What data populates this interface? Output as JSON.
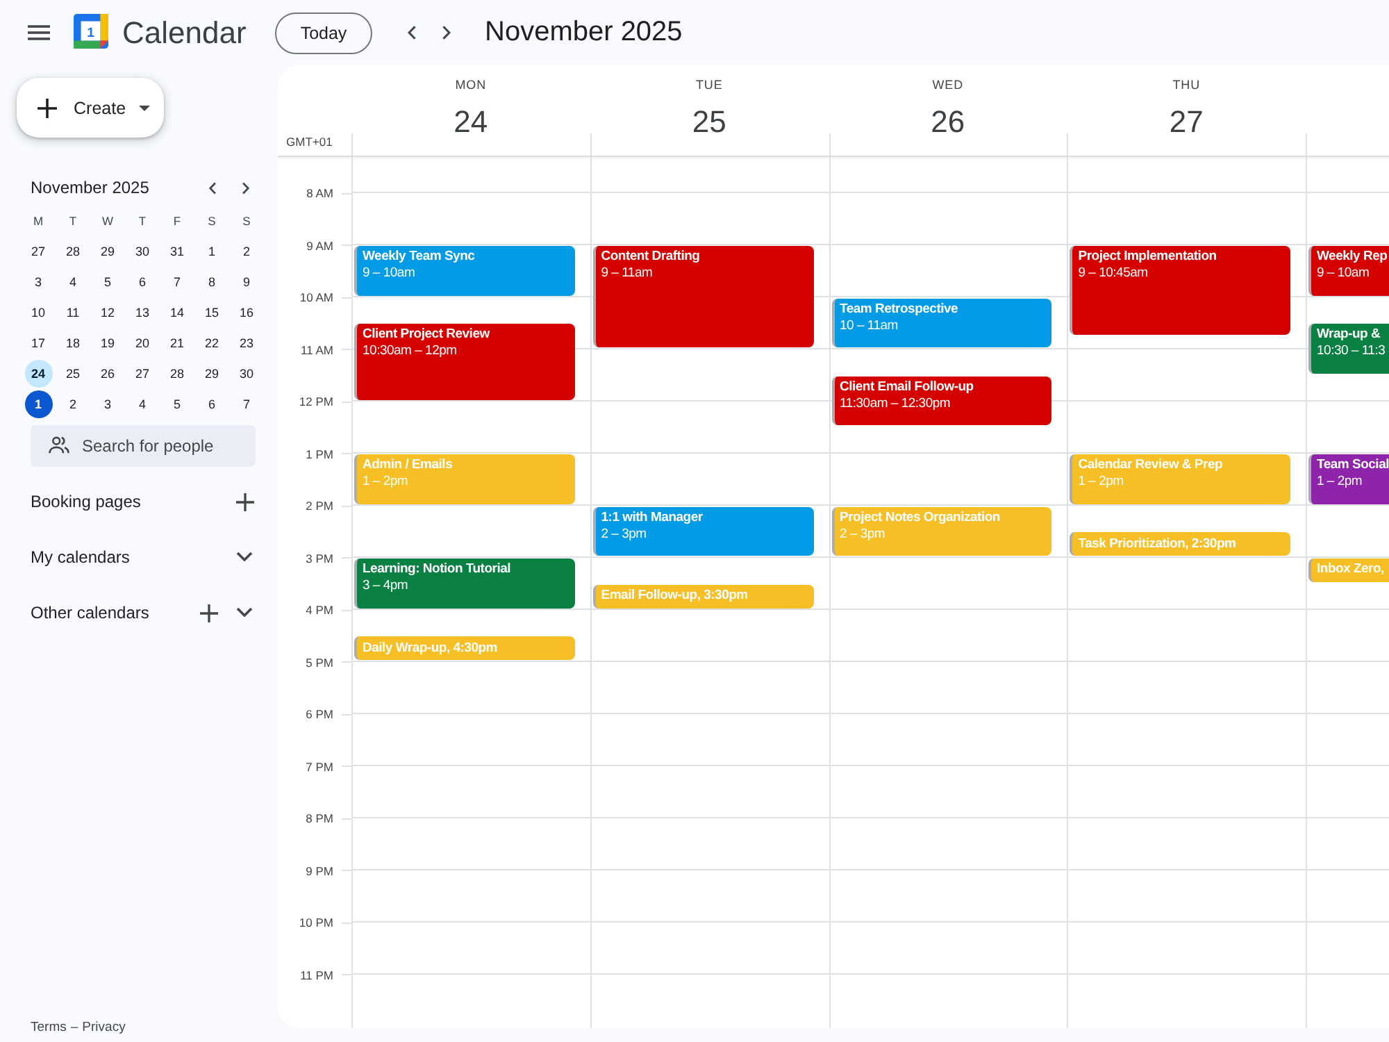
{
  "header": {
    "logo_text": "1",
    "app_name": "Calendar",
    "today_button": "Today",
    "period": "November 2025"
  },
  "create_button": {
    "label": "Create"
  },
  "mini_calendar": {
    "title": "November 2025",
    "weekdays": [
      "M",
      "T",
      "W",
      "T",
      "F",
      "S",
      "S"
    ],
    "weeks": [
      [
        {
          "day": "27",
          "selected": false,
          "today": false
        },
        {
          "day": "28",
          "selected": false,
          "today": false
        },
        {
          "day": "29",
          "selected": false,
          "today": false
        },
        {
          "day": "30",
          "selected": false,
          "today": false
        },
        {
          "day": "31",
          "selected": false,
          "today": false
        },
        {
          "day": "1",
          "selected": false,
          "today": false
        },
        {
          "day": "2",
          "selected": false,
          "today": false
        }
      ],
      [
        {
          "day": "3",
          "selected": false,
          "today": false
        },
        {
          "day": "4",
          "selected": false,
          "today": false
        },
        {
          "day": "5",
          "selected": false,
          "today": false
        },
        {
          "day": "6",
          "selected": false,
          "today": false
        },
        {
          "day": "7",
          "selected": false,
          "today": false
        },
        {
          "day": "8",
          "selected": false,
          "today": false
        },
        {
          "day": "9",
          "selected": false,
          "today": false
        }
      ],
      [
        {
          "day": "10",
          "selected": false,
          "today": false
        },
        {
          "day": "11",
          "selected": false,
          "today": false
        },
        {
          "day": "12",
          "selected": false,
          "today": false
        },
        {
          "day": "13",
          "selected": false,
          "today": false
        },
        {
          "day": "14",
          "selected": false,
          "today": false
        },
        {
          "day": "15",
          "selected": false,
          "today": false
        },
        {
          "day": "16",
          "selected": false,
          "today": false
        }
      ],
      [
        {
          "day": "17",
          "selected": false,
          "today": false
        },
        {
          "day": "18",
          "selected": false,
          "today": false
        },
        {
          "day": "19",
          "selected": false,
          "today": false
        },
        {
          "day": "20",
          "selected": false,
          "today": false
        },
        {
          "day": "21",
          "selected": false,
          "today": false
        },
        {
          "day": "22",
          "selected": false,
          "today": false
        },
        {
          "day": "23",
          "selected": false,
          "today": false
        }
      ],
      [
        {
          "day": "24",
          "selected": true,
          "today": false
        },
        {
          "day": "25",
          "selected": false,
          "today": false
        },
        {
          "day": "26",
          "selected": false,
          "today": false
        },
        {
          "day": "27",
          "selected": false,
          "today": false
        },
        {
          "day": "28",
          "selected": false,
          "today": false
        },
        {
          "day": "29",
          "selected": false,
          "today": false
        },
        {
          "day": "30",
          "selected": false,
          "today": false
        }
      ],
      [
        {
          "day": "1",
          "selected": false,
          "today": true
        },
        {
          "day": "2",
          "selected": false,
          "today": false
        },
        {
          "day": "3",
          "selected": false,
          "today": false
        },
        {
          "day": "4",
          "selected": false,
          "today": false
        },
        {
          "day": "5",
          "selected": false,
          "today": false
        },
        {
          "day": "6",
          "selected": false,
          "today": false
        },
        {
          "day": "7",
          "selected": false,
          "today": false
        }
      ]
    ]
  },
  "people_search": {
    "placeholder": "Search for people"
  },
  "sections": [
    {
      "label": "Booking pages",
      "kind": "add"
    },
    {
      "label": "My calendars",
      "kind": "collapsible",
      "expanded": false
    },
    {
      "label": "Other calendars",
      "kind": "add_collapsible",
      "expanded": false
    }
  ],
  "footer": {
    "links": [
      "Terms",
      "Privacy"
    ],
    "separator": "–"
  },
  "week": {
    "timezone": "GMT+01",
    "hours": [
      "8 AM",
      "9 AM",
      "10 AM",
      "11 AM",
      "12 PM",
      "1 PM",
      "2 PM",
      "3 PM",
      "4 PM",
      "5 PM",
      "6 PM",
      "7 PM",
      "8 PM",
      "9 PM",
      "10 PM",
      "11 PM"
    ],
    "days": [
      {
        "weekday": "MON",
        "date": "24",
        "events": [
          {
            "kind": "block",
            "title": "Weekly Team Sync",
            "time": "9 – 10am",
            "color": "#039be5"
          },
          {
            "kind": "block",
            "title": "Client Project Review",
            "time": "10:30am – 12pm",
            "color": "#d50000"
          },
          {
            "kind": "block",
            "title": "Admin / Emails",
            "time": "1 – 2pm",
            "color": "#f6bf26"
          },
          {
            "kind": "block",
            "title": "Learning: Notion Tutorial",
            "time": "3 – 4pm",
            "color": "#0b8043"
          },
          {
            "kind": "compact",
            "label": "Daily Wrap-up, 4:30pm",
            "color": "#f6bf26"
          }
        ]
      },
      {
        "weekday": "TUE",
        "date": "25",
        "events": [
          {
            "kind": "block",
            "title": "Content Drafting",
            "time": "9 – 11am",
            "color": "#d50000"
          },
          {
            "kind": "block",
            "title": "1:1 with Manager",
            "time": "2 – 3pm",
            "color": "#039be5"
          },
          {
            "kind": "compact",
            "label": "Email Follow-up, 3:30pm",
            "color": "#f6bf26"
          }
        ]
      },
      {
        "weekday": "WED",
        "date": "26",
        "events": [
          {
            "kind": "block",
            "title": "Team Retrospective",
            "time": "10 – 11am",
            "color": "#039be5"
          },
          {
            "kind": "block",
            "title": "Client Email Follow-up",
            "time": "11:30am – 12:30pm",
            "color": "#d50000"
          },
          {
            "kind": "block",
            "title": "Project Notes Organization",
            "time": "2 – 3pm",
            "color": "#f6bf26"
          }
        ]
      },
      {
        "weekday": "THU",
        "date": "27",
        "events": [
          {
            "kind": "block",
            "title": "Project Implementation",
            "time": "9 – 10:45am",
            "color": "#d50000"
          },
          {
            "kind": "block",
            "title": "Calendar Review & Prep",
            "time": "1 – 2pm",
            "color": "#f6bf26"
          },
          {
            "kind": "compact",
            "label": "Task Prioritization, 2:30pm",
            "color": "#f6bf26"
          }
        ]
      },
      {
        "events": [
          {
            "kind": "block",
            "title": "Weekly Rep",
            "time": "9 – 10am",
            "color": "#d50000"
          },
          {
            "kind": "block",
            "title": "Wrap-up &",
            "time": "10:30 – 11:3",
            "color": "#0b8043"
          },
          {
            "kind": "block",
            "title": "Team Social",
            "time": "1 – 2pm",
            "color": "#8e24aa"
          },
          {
            "kind": "compact",
            "label": "Inbox Zero,",
            "color": "#f6bf26"
          }
        ]
      }
    ]
  }
}
